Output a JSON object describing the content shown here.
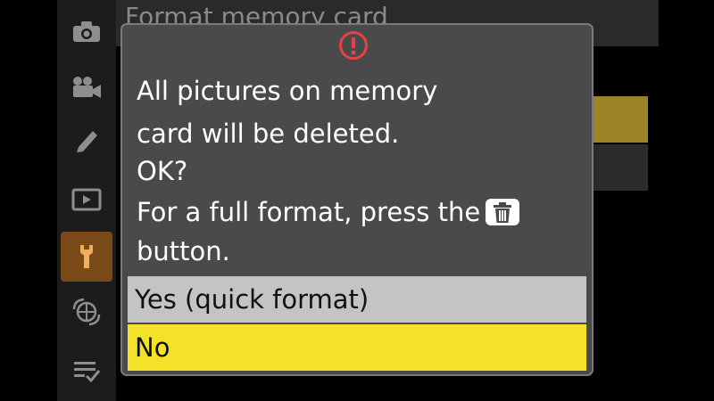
{
  "background_menu": {
    "title": "Format memory card"
  },
  "sidebar": {
    "tabs": [
      {
        "icon": "camera-icon",
        "active": false
      },
      {
        "icon": "movie-camera-icon",
        "active": false
      },
      {
        "icon": "pencil-icon",
        "active": false
      },
      {
        "icon": "playback-icon",
        "active": false
      },
      {
        "icon": "wrench-icon",
        "active": true
      },
      {
        "icon": "network-icon",
        "active": false
      },
      {
        "icon": "my-menu-icon",
        "active": false
      }
    ]
  },
  "dialog": {
    "icon": "warning-icon",
    "message_lines": [
      "All pictures on memory",
      "card will be deleted.",
      "OK?",
      "For a full format, press the",
      "button."
    ],
    "inline_icon": "trash-icon",
    "options": [
      {
        "label": "Yes (quick format)",
        "selected": false
      },
      {
        "label": "No",
        "selected": true
      }
    ]
  },
  "colors": {
    "selected_option": "#f4e12a",
    "unselected_option": "#c4c4c4",
    "dialog_background": "#4a4a4a",
    "active_tab": "#7a4a18",
    "warning": "#e8414a"
  }
}
